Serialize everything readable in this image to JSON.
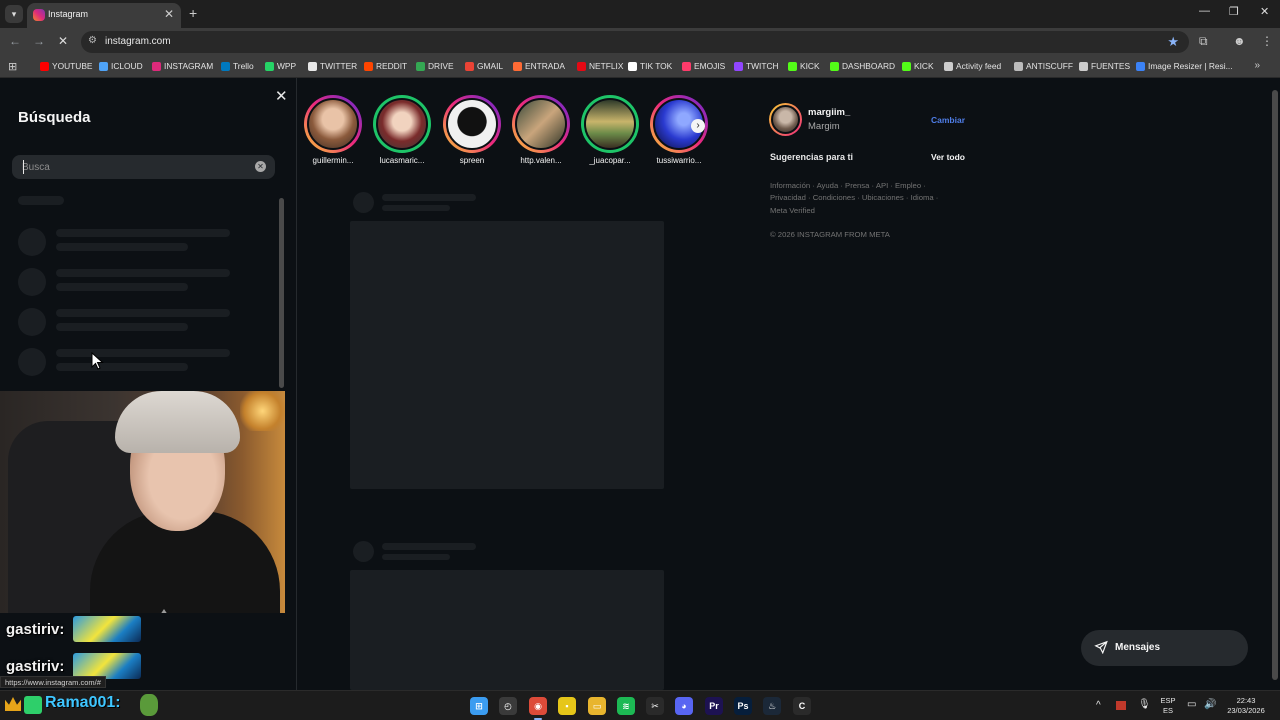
{
  "browser": {
    "tab_title": "Instagram",
    "tab_close": "✕",
    "new_tab": "+",
    "url": "instagram.com",
    "window_controls": [
      "—",
      "❐",
      "✕"
    ],
    "bookmarks": [
      {
        "label": "YOUTUBE",
        "color": "#ff0000"
      },
      {
        "label": "ICLOUD",
        "color": "#4fa3f7"
      },
      {
        "label": "INSTAGRAM",
        "color": "#dd2a7b"
      },
      {
        "label": "Trello",
        "color": "#0079bf"
      },
      {
        "label": "WPP",
        "color": "#25d366"
      },
      {
        "label": "TWITTER",
        "color": "#e8e8e8"
      },
      {
        "label": "REDDIT",
        "color": "#ff4500"
      },
      {
        "label": "DRIVE",
        "color": "#34a853"
      },
      {
        "label": "GMAIL",
        "color": "#ea4335"
      },
      {
        "label": "ENTRADA",
        "color": "#ff6b35"
      },
      {
        "label": "NETFLIX",
        "color": "#e50914"
      },
      {
        "label": "TIK TOK",
        "color": "#ffffff"
      },
      {
        "label": "EMOJIS",
        "color": "#ff3b6b"
      },
      {
        "label": "TWITCH",
        "color": "#9146ff"
      },
      {
        "label": "KICK",
        "color": "#53fc18"
      },
      {
        "label": "DASHBOARD",
        "color": "#53fc18"
      },
      {
        "label": "KICK",
        "color": "#53fc18"
      },
      {
        "label": "Activity feed",
        "color": "#cccccc"
      },
      {
        "label": "ANTISCUFF",
        "color": "#bbbbbb"
      },
      {
        "label": "FUENTES",
        "color": "#cccccc"
      },
      {
        "label": "Image Resizer | Resi...",
        "color": "#3b82f6"
      }
    ],
    "bookmarks_more": "»"
  },
  "search_panel": {
    "title": "Búsqueda",
    "close": "✕",
    "placeholder": "Busca",
    "value": "",
    "clear": "✕"
  },
  "stories": [
    {
      "username": "guillermin...",
      "ring": "gradient"
    },
    {
      "username": "lucasmaric...",
      "ring": "green"
    },
    {
      "username": "spreen",
      "ring": "gradient"
    },
    {
      "username": "http.valen...",
      "ring": "gradient"
    },
    {
      "username": "_juacopar...",
      "ring": "green"
    },
    {
      "username": "tussiwarrio...",
      "ring": "gradient"
    }
  ],
  "stories_next": "›",
  "sidebar": {
    "username": "margiim_",
    "name": "Margim",
    "switch_label": "Cambiar",
    "suggestions_label": "Sugerencias para ti",
    "see_all_label": "Ver todo",
    "footer_lines": [
      "Información · Ayuda · Prensa · API · Empleo ·",
      "Privacidad · Condiciones · Ubicaciones · Idioma ·",
      "Meta Verified"
    ],
    "copyright": "© 2026 INSTAGRAM FROM META"
  },
  "messages": {
    "label": "Mensajes",
    "icon": "send-icon"
  },
  "overlay": {
    "chat": [
      {
        "user": "gastiriv:"
      },
      {
        "user": "gastiriv:"
      }
    ],
    "chat_bottom_user": "Rama001:",
    "chat_bottom_colon": ":",
    "status_url": "https://www.instagram.com/#"
  },
  "taskbar": {
    "lang_top": "ESP",
    "lang_bottom": "ES",
    "time": "22:43",
    "date": "23/03/2026",
    "apps": [
      {
        "name": "windows-start",
        "color": "#3b9cf0",
        "glyph": "⊞"
      },
      {
        "name": "app-1",
        "color": "#3a3a3a",
        "glyph": "◴"
      },
      {
        "name": "chrome",
        "color": "#dd4b39",
        "glyph": "◉"
      },
      {
        "name": "sticky-notes",
        "color": "#e6c619",
        "glyph": "▪"
      },
      {
        "name": "file-explorer",
        "color": "#e8b52e",
        "glyph": "▭"
      },
      {
        "name": "spotify",
        "color": "#1db954",
        "glyph": "≋"
      },
      {
        "name": "app-capcut",
        "color": "#2a2a2a",
        "glyph": "✂"
      },
      {
        "name": "discord",
        "color": "#5865f2",
        "glyph": "◕"
      },
      {
        "name": "premiere",
        "color": "#1d1252",
        "glyph": "Pr"
      },
      {
        "name": "photoshop",
        "color": "#061e3b",
        "glyph": "Ps"
      },
      {
        "name": "steam",
        "color": "#1b2838",
        "glyph": "♨"
      },
      {
        "name": "ccleaner",
        "color": "#2a2a2a",
        "glyph": "C"
      }
    ]
  },
  "colors": {
    "accent_blue": "#4f7ee8",
    "background": "#0c1014",
    "panel": "#262a2e"
  }
}
